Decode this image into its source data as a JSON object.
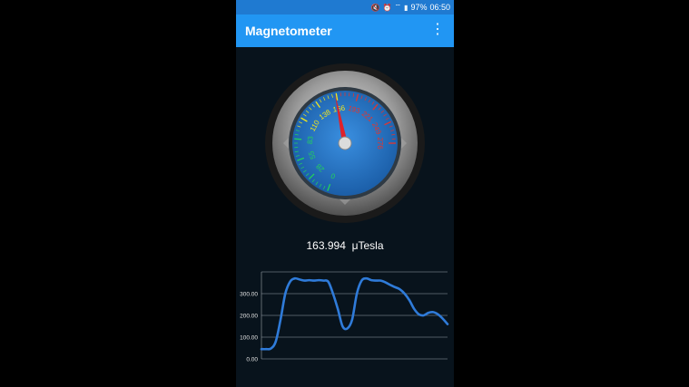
{
  "status_bar": {
    "icons": [
      "mute-icon",
      "alarm-icon",
      "wifi-icon",
      "signal-icon"
    ],
    "battery": "97%",
    "time": "06:50"
  },
  "app_bar": {
    "title": "Magnetometer",
    "menu_icon": "overflow-menu-icon"
  },
  "gauge": {
    "scale_labels": [
      "0",
      "28",
      "55",
      "83",
      "110",
      "138",
      "166",
      "193",
      "221",
      "249",
      "276"
    ],
    "value": 163.994,
    "colors": {
      "green": "#22d35a",
      "yellow": "#f2e61c",
      "red": "#e8342a",
      "face": "#2a79c9",
      "needle": "#e0222a"
    }
  },
  "reading": {
    "value": "163.994",
    "unit": "μTesla"
  },
  "chart_data": {
    "type": "line",
    "yticks": [
      "0.00",
      "100.00",
      "200.00",
      "300.00"
    ],
    "ylim": [
      0,
      400
    ],
    "line_color": "#2f7bd9",
    "series": [
      {
        "values": [
          45,
          45,
          48,
          80,
          180,
          300,
          355,
          370,
          365,
          360,
          362,
          360,
          362,
          360,
          355,
          300,
          230,
          150,
          140,
          180,
          300,
          360,
          370,
          362,
          360,
          360,
          352,
          340,
          330,
          320,
          300,
          270,
          230,
          205,
          200,
          212,
          215,
          205,
          185,
          160
        ]
      }
    ]
  }
}
